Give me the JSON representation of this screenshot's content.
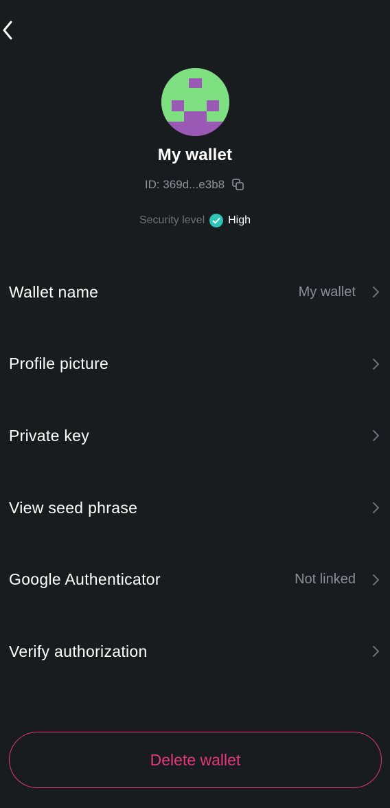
{
  "header": {
    "back_icon": "chevron-left-icon"
  },
  "profile": {
    "avatar_colors": {
      "background": "#9b59b6",
      "pattern": "#7ee081"
    },
    "name": "My wallet",
    "id": "ID: 369d...e3b8",
    "copy_icon": "copy-icon",
    "security_label": "Security level",
    "security_value": "High",
    "security_icon_color": "#2ec4b6"
  },
  "menu": {
    "items": [
      {
        "label": "Wallet name",
        "value": "My wallet"
      },
      {
        "label": "Profile picture",
        "value": ""
      },
      {
        "label": "Private key",
        "value": ""
      },
      {
        "label": "View seed phrase",
        "value": ""
      },
      {
        "label": "Google Authenticator",
        "value": "Not linked"
      },
      {
        "label": "Verify authorization",
        "value": ""
      }
    ]
  },
  "footer": {
    "delete_label": "Delete wallet",
    "delete_color": "#e23a7a"
  }
}
